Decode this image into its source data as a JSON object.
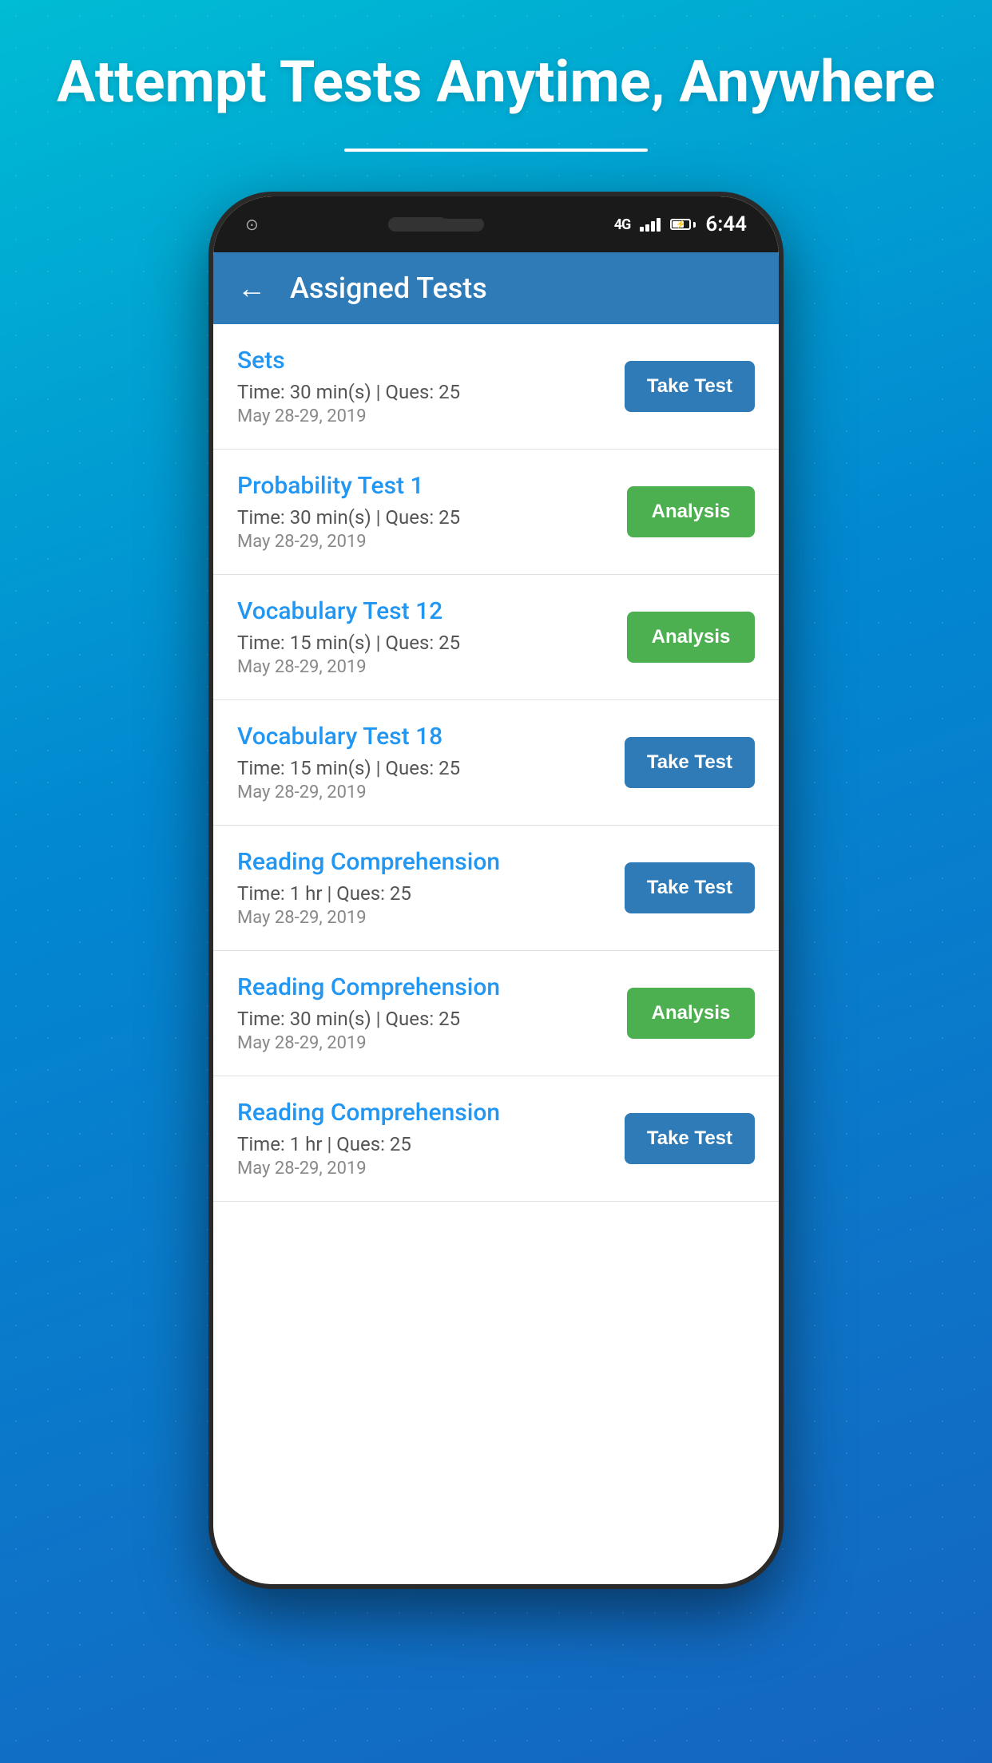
{
  "page": {
    "hero_title": "Attempt Tests Anytime, Anywhere",
    "status": {
      "time": "6:44",
      "network": "4G",
      "battery_level": "70"
    },
    "header": {
      "title": "Assigned Tests",
      "back_label": "←"
    },
    "tests": [
      {
        "id": 1,
        "name": "Sets",
        "time": "Time: 30 min(s) | Ques: 25",
        "date": "May 28-29, 2019",
        "button_label": "Take Test",
        "button_type": "take"
      },
      {
        "id": 2,
        "name": "Probability Test 1",
        "time": "Time: 30 min(s) | Ques: 25",
        "date": "May 28-29, 2019",
        "button_label": "Analysis",
        "button_type": "analysis"
      },
      {
        "id": 3,
        "name": "Vocabulary Test 12",
        "time": "Time: 15 min(s) | Ques: 25",
        "date": "May 28-29, 2019",
        "button_label": "Analysis",
        "button_type": "analysis"
      },
      {
        "id": 4,
        "name": "Vocabulary Test 18",
        "time": "Time: 15 min(s) | Ques: 25",
        "date": "May 28-29, 2019",
        "button_label": "Take Test",
        "button_type": "take"
      },
      {
        "id": 5,
        "name": "Reading Comprehension",
        "time": "Time: 1 hr | Ques: 25",
        "date": "May 28-29, 2019",
        "button_label": "Take Test",
        "button_type": "take"
      },
      {
        "id": 6,
        "name": "Reading Comprehension",
        "time": "Time: 30 min(s) | Ques: 25",
        "date": "May 28-29, 2019",
        "button_label": "Analysis",
        "button_type": "analysis"
      },
      {
        "id": 7,
        "name": "Reading Comprehension",
        "time": "Time: 1 hr | Ques: 25",
        "date": "May 28-29, 2019",
        "button_label": "Take Test",
        "button_type": "take"
      }
    ]
  }
}
